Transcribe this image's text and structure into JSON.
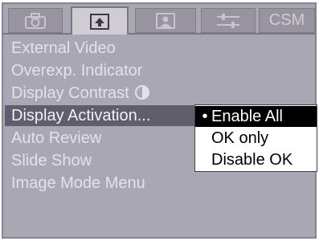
{
  "tabs": [
    {
      "icon": "camera-icon",
      "label": ""
    },
    {
      "icon": "playback-icon",
      "label": ""
    },
    {
      "icon": "portrait-icon",
      "label": ""
    },
    {
      "icon": "settings-sliders-icon",
      "label": ""
    },
    {
      "icon": "",
      "label": "CSM"
    }
  ],
  "active_tab": 1,
  "menu": {
    "items": [
      {
        "label": "External Video",
        "selected": false
      },
      {
        "label": "Overexp. Indicator",
        "selected": false
      },
      {
        "label": "Display Contrast",
        "selected": false,
        "icon": "contrast-icon"
      },
      {
        "label": "Display Activation...",
        "selected": true
      },
      {
        "label": "Auto Review",
        "selected": false
      },
      {
        "label": "Slide Show",
        "selected": false
      },
      {
        "label": "Image Mode Menu",
        "selected": false
      }
    ]
  },
  "submenu": {
    "options": [
      {
        "label": "Enable All",
        "checked": true,
        "marker": "•"
      },
      {
        "label": "OK only",
        "checked": false,
        "marker": ""
      },
      {
        "label": "Disable OK",
        "checked": false,
        "marker": ""
      }
    ]
  },
  "colors": {
    "background": "#a9a7b4",
    "selected_row": "#605d6c",
    "menu_text": "#e4e2e8",
    "submenu_bg": "#ffffff",
    "submenu_checked_bg": "#000000"
  }
}
